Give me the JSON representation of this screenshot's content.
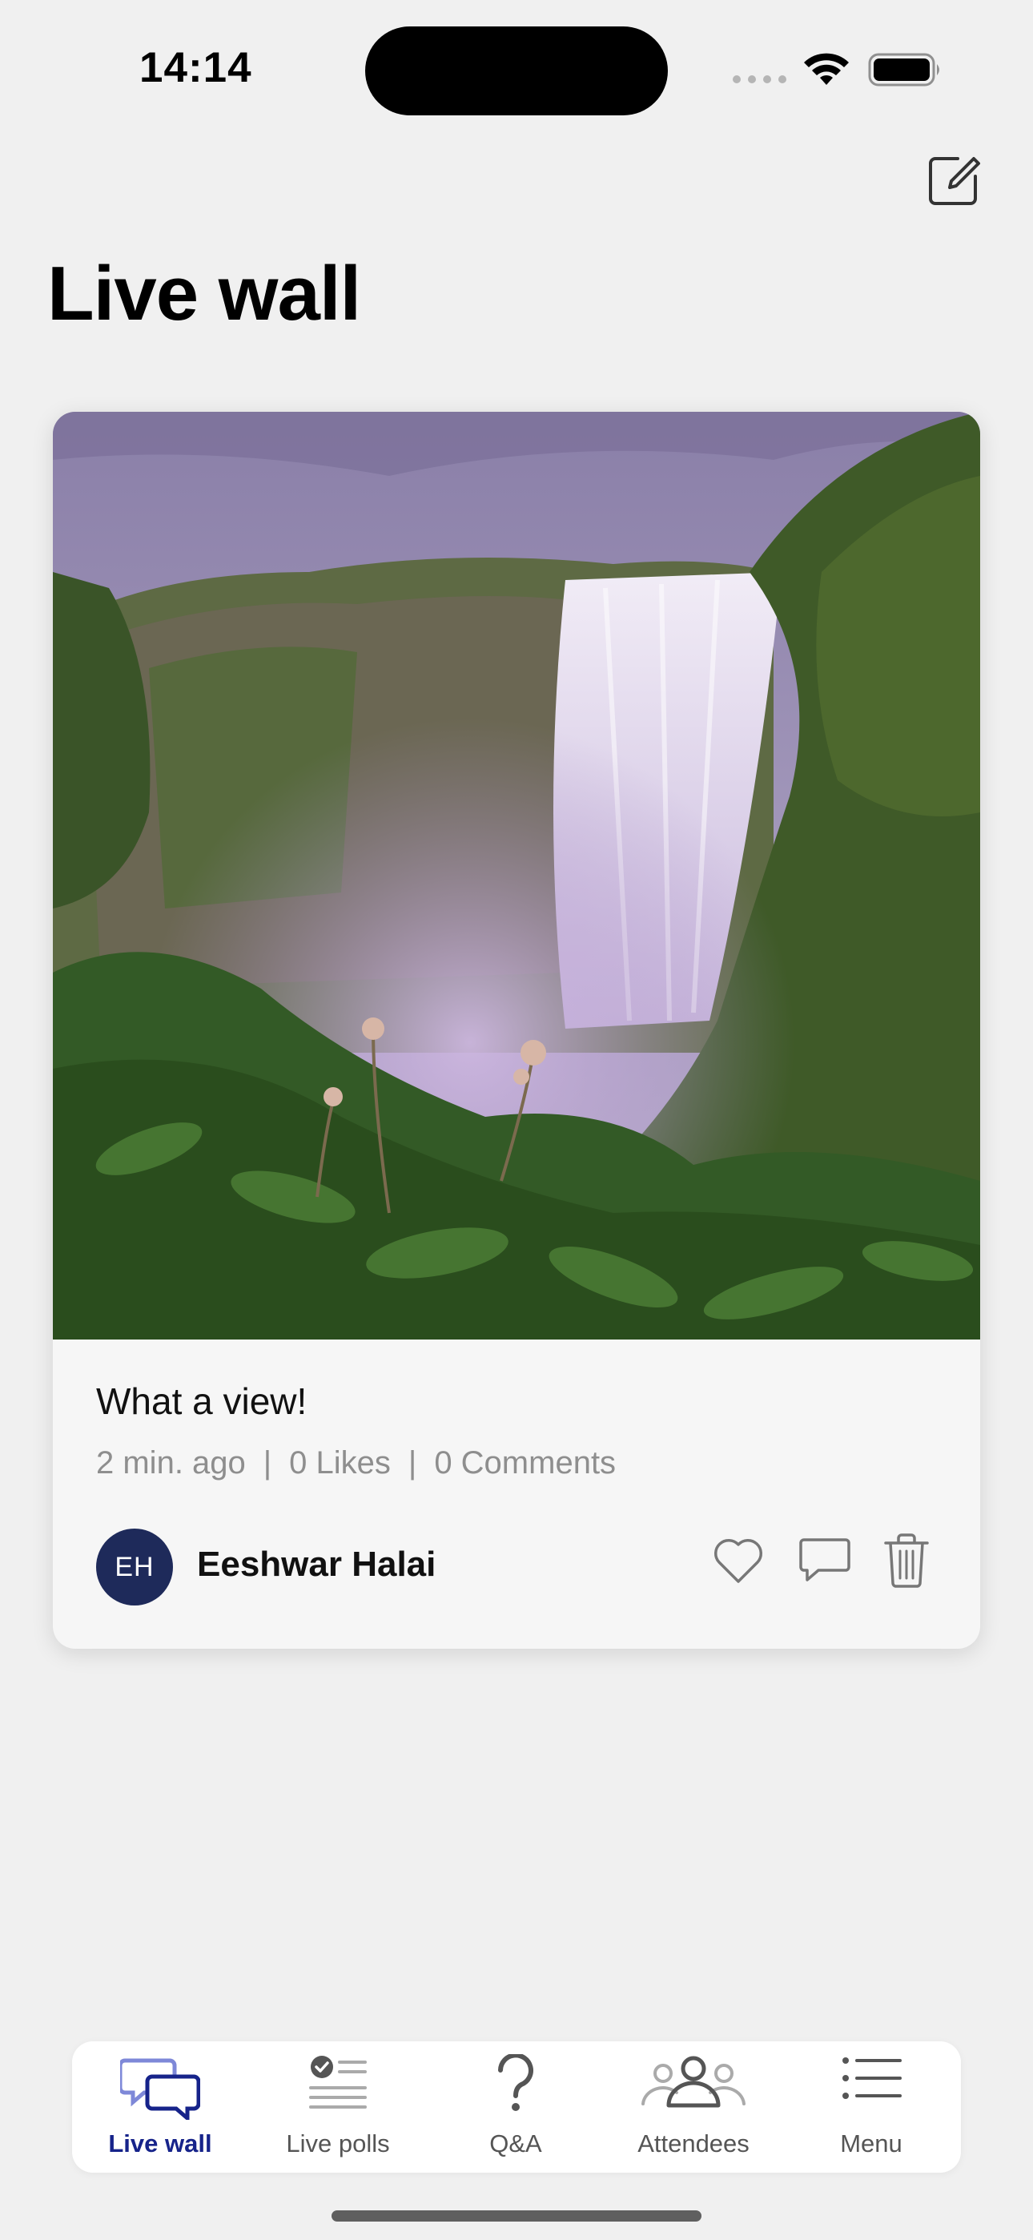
{
  "status_bar": {
    "time": "14:14",
    "icons": [
      "cellular-dots-icon",
      "wifi-icon",
      "battery-icon"
    ]
  },
  "header": {
    "title": "Live wall",
    "compose_icon": "compose-icon"
  },
  "post": {
    "image_subject": "waterfall",
    "caption": "What a view!",
    "time_ago": "2 min. ago",
    "likes": "0 Likes",
    "comments": "0 Comments",
    "separator": "|",
    "author": {
      "initials": "EH",
      "name": "Eeshwar Halai"
    },
    "actions": [
      "heart-icon",
      "comment-icon",
      "trash-icon"
    ]
  },
  "tabs": [
    {
      "label": "Live wall",
      "icon": "chat-bubbles-icon",
      "active": true
    },
    {
      "label": "Live polls",
      "icon": "poll-list-icon",
      "active": false
    },
    {
      "label": "Q&A",
      "icon": "question-mark-icon",
      "active": false
    },
    {
      "label": "Attendees",
      "icon": "people-icon",
      "active": false
    },
    {
      "label": "Menu",
      "icon": "menu-list-icon",
      "active": false
    }
  ],
  "colors": {
    "accent": "#16238a",
    "avatar_bg": "#1e2a5a",
    "background": "#f0f0f0"
  }
}
